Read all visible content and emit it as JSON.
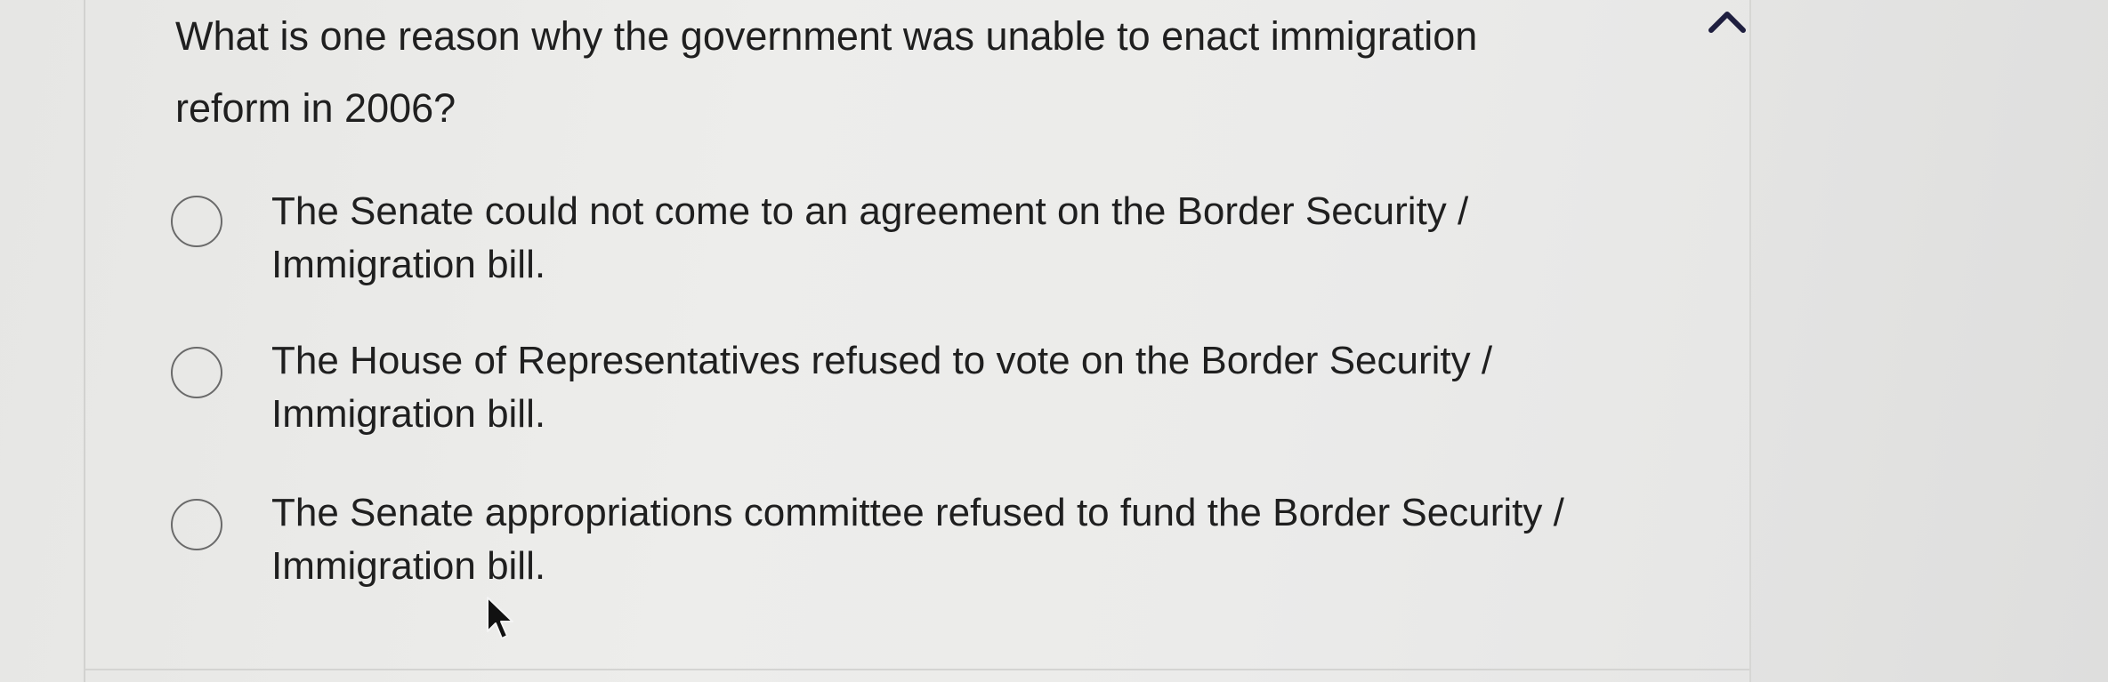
{
  "question": {
    "text": "What is one reason why the government was unable to enact immigration reform in 2006?"
  },
  "options": [
    {
      "label": "The Senate could not come to an agreement on the Border Security / Immigration bill.",
      "selected": false
    },
    {
      "label": "The House of Representatives refused to vote on the Border Security / Immigration bill.",
      "selected": false
    },
    {
      "label": "The Senate appropriations committee refused to fund the Border Security / Immigration bill.",
      "selected": false
    }
  ],
  "icons": {
    "collapse": "chevron-up-icon",
    "pointer": "mouse-cursor-icon"
  }
}
